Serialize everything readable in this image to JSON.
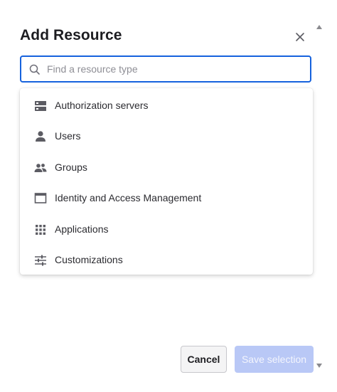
{
  "dialog": {
    "title": "Add Resource",
    "close_icon": "close-icon"
  },
  "search": {
    "placeholder": "Find a resource type",
    "value": "",
    "icon": "search-icon",
    "focus_color": "#1662dd"
  },
  "options": [
    {
      "label": "Authorization servers",
      "icon": "server-icon"
    },
    {
      "label": "Users",
      "icon": "user-icon"
    },
    {
      "label": "Groups",
      "icon": "group-icon"
    },
    {
      "label": "Identity and Access Management",
      "icon": "window-icon"
    },
    {
      "label": "Applications",
      "icon": "apps-grid-icon"
    },
    {
      "label": "Customizations",
      "icon": "sliders-icon"
    }
  ],
  "footer": {
    "cancel_label": "Cancel",
    "save_label": "Save selection",
    "save_disabled_color": "#b9c8f6"
  }
}
